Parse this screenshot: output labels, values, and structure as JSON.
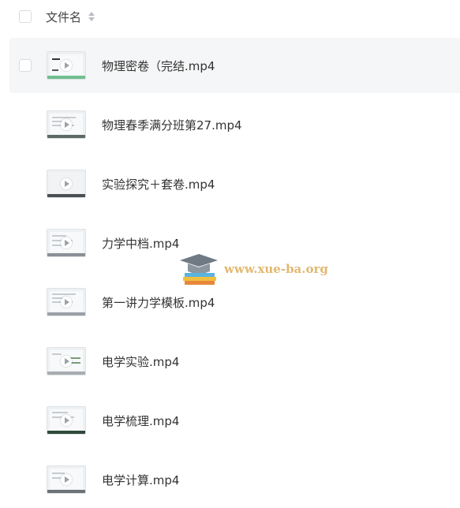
{
  "header": {
    "column_label": "文件名"
  },
  "files": [
    {
      "name": "物理密卷（完结.mp4"
    },
    {
      "name": "物理春季满分班第27.mp4"
    },
    {
      "name": "实验探究＋套卷.mp4"
    },
    {
      "name": "力学中档.mp4"
    },
    {
      "name": "第一讲力学模板.mp4"
    },
    {
      "name": "电学实验.mp4"
    },
    {
      "name": "电学梳理.mp4"
    },
    {
      "name": "电学计算.mp4"
    }
  ],
  "watermark": {
    "text": "www.xue-ba.org"
  },
  "colors": {
    "hover_row": "#f5f6f7",
    "text": "#333333",
    "watermark": "#e2b870"
  }
}
